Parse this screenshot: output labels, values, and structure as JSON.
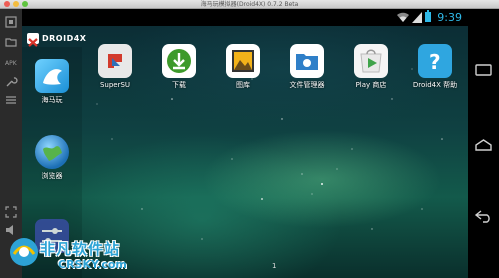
{
  "window": {
    "title": "海马玩模拟器(Droid4X) 0.7.2 Beta"
  },
  "statusbar": {
    "time": "9:39"
  },
  "brand": {
    "logo_text": "DROID4X"
  },
  "drawer": {
    "items": [
      {
        "label": "海马玩",
        "icon": "haimawan-icon"
      },
      {
        "label": "浏览器",
        "icon": "browser-globe-icon"
      }
    ]
  },
  "apps": [
    {
      "label": "SuperSU",
      "icon": "supersu-icon",
      "color": "#e8e8e8"
    },
    {
      "label": "下载",
      "icon": "download-icon",
      "color": "#3d9a2b"
    },
    {
      "label": "图库",
      "icon": "gallery-icon",
      "color": "#f3b21a"
    },
    {
      "label": "文件管理器",
      "icon": "file-manager-icon",
      "color": "#2f7fc8"
    },
    {
      "label": "Play 商店",
      "icon": "play-store-icon",
      "color": "#f5f5f5"
    },
    {
      "label": "Droid4X 帮助",
      "icon": "help-icon",
      "color": "#2fa6e0"
    }
  ],
  "home": {
    "page_indicator": "1"
  },
  "watermark": {
    "cn": "非凡软件站",
    "en": "CRSKY.com"
  },
  "colors": {
    "status_accent": "#2fb9e8",
    "sidebar_bg": "#2b2b2b",
    "navbar_bg": "#000000"
  }
}
